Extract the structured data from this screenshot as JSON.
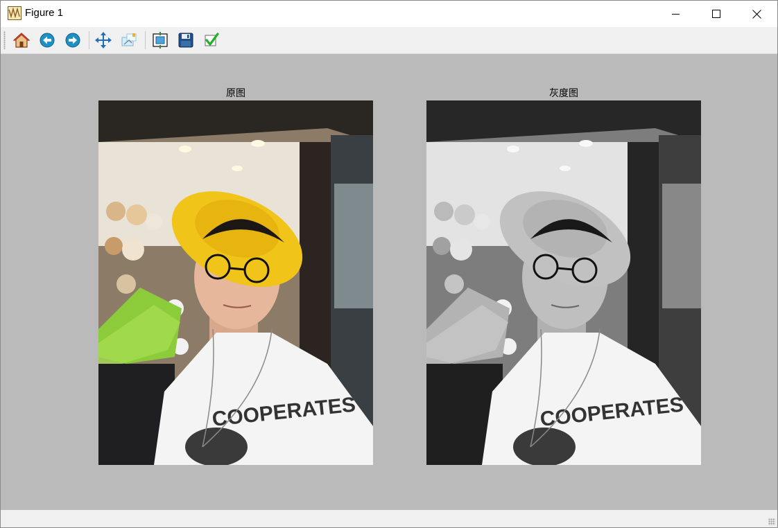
{
  "window": {
    "title": "Figure 1",
    "controls": [
      "minimize-icon",
      "maximize-icon",
      "close-icon"
    ]
  },
  "toolbar": {
    "buttons": [
      {
        "name": "home-button",
        "icon": "home-icon"
      },
      {
        "name": "back-button",
        "icon": "back-arrow-icon"
      },
      {
        "name": "forward-button",
        "icon": "forward-arrow-icon"
      },
      {
        "name": "pan-button",
        "icon": "pan-arrows-icon"
      },
      {
        "name": "zoom-button",
        "icon": "zoom-rect-icon"
      },
      {
        "name": "subplots-button",
        "icon": "configure-subplots-icon"
      },
      {
        "name": "save-button",
        "icon": "floppy-disk-icon"
      },
      {
        "name": "edit-parameters-button",
        "icon": "checkmark-icon"
      }
    ]
  },
  "figure": {
    "background": "#bababa",
    "subplots": [
      {
        "title": "原图",
        "content": "color photo"
      },
      {
        "title": "灰度图",
        "content": "grayscale photo"
      }
    ]
  },
  "colors": {
    "hat_yellow": "#f0c419",
    "hanger_green": "#8ccb3a",
    "shirt_white": "#f4f4f4"
  }
}
